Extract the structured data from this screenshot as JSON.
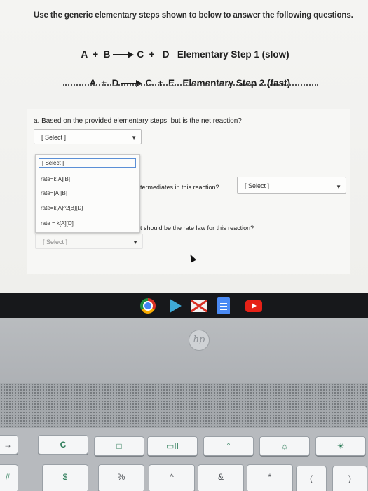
{
  "instructions": "Use the generic elementary steps shown to below to answer the following questions.",
  "steps": [
    {
      "reactants": "A  +  B",
      "products": "C  +   D",
      "label": "Elementary Step 1 (slow)"
    },
    {
      "reactants": "A  +  D",
      "products": "C  +  E",
      "label": "Elementary Step 2 (fast)"
    }
  ],
  "question_a": {
    "text": "a. Based on the provided elementary steps, but is the net reaction?",
    "selected_value": "[ Select ]"
  },
  "question_b": {
    "text_visible": "termediates in this reaction?",
    "selected_value": "[ Select ]"
  },
  "question_c": {
    "text_visible": "t should be the rate law for this reaction?",
    "selected_value": "[ Select ]"
  },
  "dropdown": {
    "options": [
      "[ Select ]",
      "rate=k[A][B]",
      "rate=[A][B]",
      "rate=k[A]^2[B][D]",
      "rate = k[A][D]"
    ],
    "highlighted_index": 0
  },
  "shelf_apps": [
    "chrome-icon",
    "play-store-icon",
    "gmail-icon",
    "docs-icon",
    "youtube-icon"
  ],
  "hp_logo": "hp",
  "keyboard": {
    "row1": [
      "→",
      "C",
      "□",
      "▭II",
      "°",
      "☼",
      "☀"
    ],
    "row2": [
      "#",
      "$",
      "%",
      "^",
      "&",
      "*",
      "(",
      ")"
    ]
  }
}
